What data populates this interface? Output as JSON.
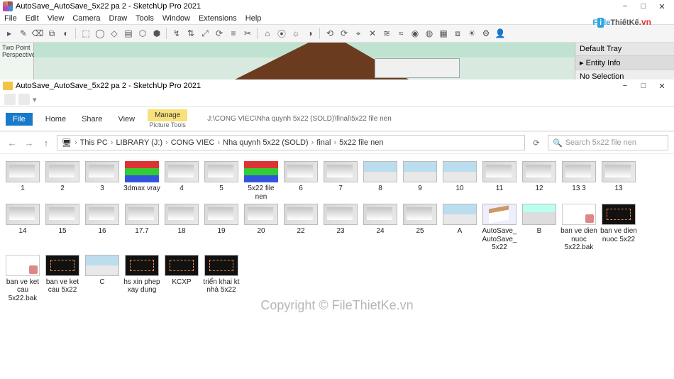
{
  "sketchup": {
    "title": "AutoSave_AutoSave_5x22 pa 2 - SketchUp Pro 2021",
    "menu": [
      "File",
      "Edit",
      "View",
      "Camera",
      "Draw",
      "Tools",
      "Window",
      "Extensions",
      "Help"
    ],
    "viewport_label": "Two Point\nPerspective",
    "tray": {
      "title": "Default Tray",
      "panel": "Entity Info",
      "selection": "No Selection"
    }
  },
  "logo": {
    "p1": "F",
    "p2": "i",
    "p3": "le",
    "p4": "ThiếtKế",
    "p5": ".vn"
  },
  "explorer": {
    "title": "AutoSave_AutoSave_5x22 pa 2 - SketchUp Pro 2021",
    "ribbon": {
      "file": "File",
      "home": "Home",
      "share": "Share",
      "view": "View",
      "manage": "Manage",
      "manage_group": "Picture Tools",
      "path_lite": "J:\\CONG VIEC\\Nha quynh 5x22 (SOLD)\\final\\5x22 file nen"
    },
    "breadcrumb": [
      "This PC",
      "LIBRARY (J:)",
      "CONG VIEC",
      "Nha quynh 5x22 (SOLD)",
      "final",
      "5x22 file nen"
    ],
    "search_placeholder": "Search 5x22 file nen",
    "files": [
      {
        "name": "1",
        "t": "interior"
      },
      {
        "name": "2",
        "t": "interior"
      },
      {
        "name": "3",
        "t": "interior"
      },
      {
        "name": "3dmax vray",
        "t": "rar"
      },
      {
        "name": "4",
        "t": "interior"
      },
      {
        "name": "5",
        "t": "interior"
      },
      {
        "name": "5x22 file nen",
        "t": "rar"
      },
      {
        "name": "6",
        "t": "interior"
      },
      {
        "name": "7",
        "t": "interior"
      },
      {
        "name": "8",
        "t": "exterior"
      },
      {
        "name": "9",
        "t": "exterior"
      },
      {
        "name": "10",
        "t": "exterior"
      },
      {
        "name": "11",
        "t": "interior"
      },
      {
        "name": "12",
        "t": "interior"
      },
      {
        "name": "13 3",
        "t": "interior"
      },
      {
        "name": "13",
        "t": "interior"
      },
      {
        "name": "14",
        "t": "interior"
      },
      {
        "name": "15",
        "t": "interior"
      },
      {
        "name": "16",
        "t": "interior"
      },
      {
        "name": "17.7",
        "t": "interior"
      },
      {
        "name": "18",
        "t": "interior"
      },
      {
        "name": "19",
        "t": "interior"
      },
      {
        "name": "20",
        "t": "interior"
      },
      {
        "name": "22",
        "t": "interior"
      },
      {
        "name": "23",
        "t": "interior"
      },
      {
        "name": "24",
        "t": "interior"
      },
      {
        "name": "25",
        "t": "interior"
      },
      {
        "name": "A",
        "t": "exterior"
      },
      {
        "name": "AutoSave_AutoSave_5x22",
        "t": "su"
      },
      {
        "name": "B",
        "t": "iso"
      },
      {
        "name": "ban ve dien nuoc 5x22.bak",
        "t": "doc"
      },
      {
        "name": "ban ve dien nuoc 5x22",
        "t": "cad"
      },
      {
        "name": "ban ve ket cau 5x22.bak",
        "t": "doc"
      },
      {
        "name": "ban ve ket cau 5x22",
        "t": "cad"
      },
      {
        "name": "C",
        "t": "exterior"
      },
      {
        "name": "hs xin phep xay dung",
        "t": "cad"
      },
      {
        "name": "KCXP",
        "t": "cad"
      },
      {
        "name": "triển khai kt nhà 5x22",
        "t": "cad"
      }
    ]
  },
  "watermark": "Copyright © FileThietKe.vn"
}
